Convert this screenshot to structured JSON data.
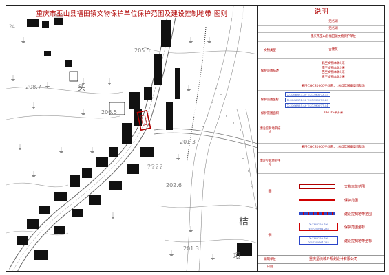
{
  "map": {
    "title": "重庆市巫山县福田镇文物保护单位保护范围及建设控制地带-图则",
    "spot_heights": [
      "205.5",
      "208.7",
      "206.5",
      "201.3",
      "202.6",
      "201.3"
    ],
    "place_labels": [
      "24",
      "头",
      "桔",
      "项"
    ],
    "question_marks": "????"
  },
  "panel": {
    "title": "说明",
    "rows": [
      {
        "label": "",
        "lines": [
          "无名湖"
        ]
      },
      {
        "label": "",
        "lines": [
          "无名湖"
        ]
      },
      {
        "label": "",
        "lines": [
          "重庆市巫山县福田镇文物保护单位"
        ]
      },
      {
        "label": "文物类型",
        "lines": [
          "古建筑"
        ]
      },
      {
        "label": "保护范围描述",
        "lines": [
          "北至文物本体1米",
          "南至文物本体1米",
          "西至文物本体1米",
          "东至文物本体1米"
        ]
      },
      {
        "label": "",
        "lines": [
          "采用CGCS2000坐标系，1985年国家高程基准"
        ]
      },
      {
        "label": "保护范围坐标",
        "coords": [
          "X:3366873.39  Y:37390073.15",
          "X:3366874.22  Y:37390079.28",
          "X:3366855.40  Y:37390077.44",
          "X:3366855.79  Y:37390071.16"
        ]
      },
      {
        "label": "保护范围面积",
        "lines": [
          "384.35平方米"
        ]
      },
      {
        "label": "建设控制地带描述",
        "lines": [
          ""
        ]
      },
      {
        "label": "",
        "lines": [
          "采用CGCS2000坐标系，1985年国家高程基准"
        ]
      },
      {
        "label": "建设控制地带坐标",
        "lines": [
          ""
        ]
      }
    ],
    "legend_label_top": "图",
    "legend_label_bottom": "例",
    "legend": [
      {
        "name": "文物本体范围",
        "kind": "hollow-red"
      },
      {
        "name": "保护范围",
        "kind": "red-line"
      },
      {
        "name": "建设控制地带范围",
        "kind": "blue-red-line"
      },
      {
        "name": "保护范围坐标",
        "kind": "coord-red",
        "sample": "X:3366750.790  Y:37390761.293"
      },
      {
        "name": "建设控制地带坐标",
        "kind": "coord-blue",
        "sample": "X:3366750.790  Y:37390761.293"
      }
    ],
    "footer": [
      {
        "label": "编制单位",
        "value": "重庆星沅城乡规划设计有限公司"
      },
      {
        "label": "日期",
        "value": ""
      }
    ]
  },
  "colors": {
    "red": "#b00000",
    "blue": "#2a45c8",
    "building": "#111111"
  }
}
